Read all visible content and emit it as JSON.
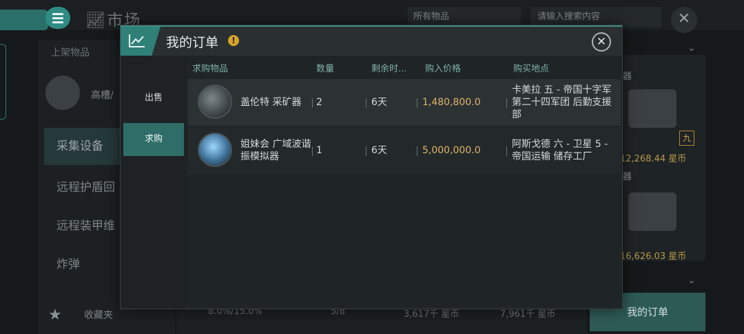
{
  "market": {
    "title": "市场",
    "filter_value": "所有物品",
    "search_placeholder": "请输入搜索内容",
    "left_tab": "上架物品",
    "slot_label": "高槽/",
    "categories": [
      "采集设备",
      "远程护盾回",
      "远程装甲维",
      "炸弹"
    ],
    "favorites_label": "收藏夹",
    "stats": [
      "8.0%/15.0%",
      "5/8",
      "3,617千 星币",
      "7,961千 星币"
    ],
    "right_prices": [
      "12,268.44 星币",
      "16,626.03 星币"
    ],
    "right_labels": [
      "器",
      "器"
    ],
    "right_badge": "九",
    "my_orders_button": "我的订单"
  },
  "dialog": {
    "title": "我的订单",
    "tabs": [
      "出售",
      "求购"
    ],
    "active_tab": "求购",
    "columns": [
      "求购物品",
      "数量",
      "剩余时...",
      "购入价格",
      "购买地点"
    ],
    "orders": [
      {
        "item": "盖伦特 采矿器",
        "qty": "2",
        "remaining": "6天",
        "price": "1,480,800.0",
        "location": "卡美拉 五 - 帝国十字军第二十四军团 后勤支援部",
        "icon": "mining-laser-icon"
      },
      {
        "item": "姐妹会 广域波谐振模拟器",
        "qty": "1",
        "remaining": "6天",
        "price": "5,000,000.0",
        "location": "阿斯戈德 六 - 卫星 5 - 帝国运输 储存工厂",
        "icon": "scanner-probe-icon"
      }
    ]
  },
  "colors": {
    "accent": "#2f8077",
    "price": "#e0b568",
    "header_text": "#7fb1ab"
  }
}
